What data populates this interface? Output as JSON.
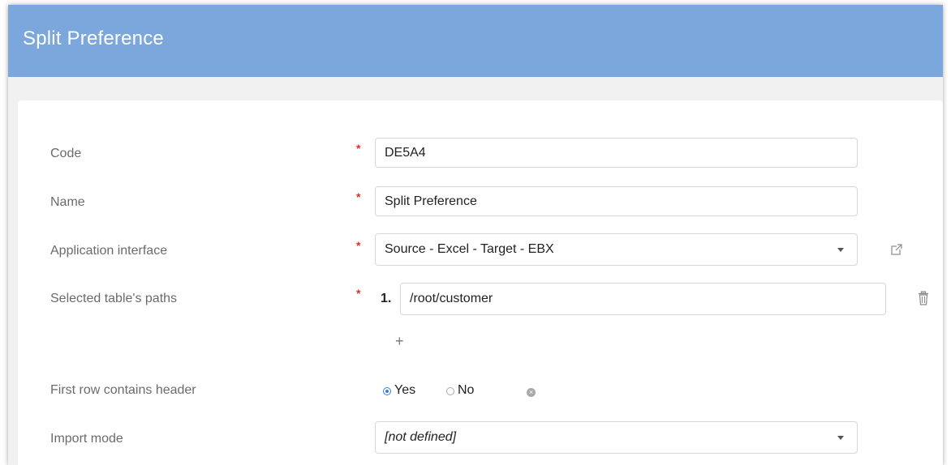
{
  "title": "Split Preference",
  "form": {
    "code": {
      "label": "Code",
      "value": "DE5A4"
    },
    "name": {
      "label": "Name",
      "value": "Split Preference"
    },
    "application_interface": {
      "label": "Application interface",
      "value": "Source - Excel - Target - EBX"
    },
    "selected_paths": {
      "label": "Selected table's paths",
      "index": "1.",
      "value": "/root/customer",
      "add_label": "+"
    },
    "first_row_header": {
      "label": "First row contains header",
      "yes_label": "Yes",
      "no_label": "No",
      "selected": "Yes"
    },
    "import_mode": {
      "label": "Import mode",
      "value": "[not defined]"
    },
    "required_marker": "*"
  },
  "colors": {
    "title_bar": "#7ba7dc",
    "required": "#d0342c",
    "radio_accent": "#3b7de0"
  },
  "icons": {
    "open": "external-link-icon",
    "delete": "trash-icon",
    "clear": "clear-icon"
  }
}
